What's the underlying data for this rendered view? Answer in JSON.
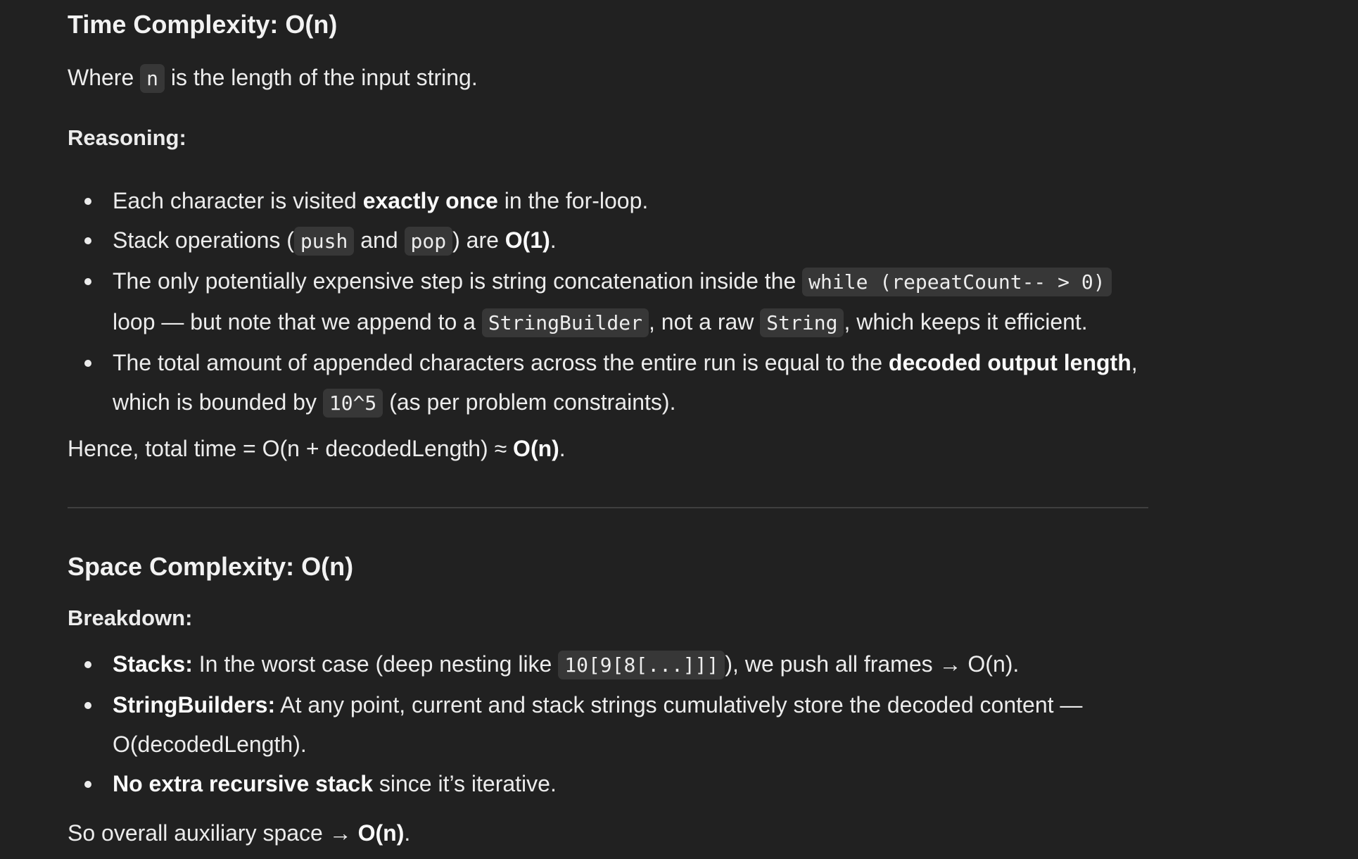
{
  "time": {
    "heading": "Time Complexity: O(n)",
    "where_pre": "Where ",
    "where_code": "n",
    "where_post": " is the length of the input string.",
    "reasoning_label": "Reasoning:",
    "bullets": {
      "b1": {
        "pre": "Each character is visited ",
        "bold": "exactly once",
        "post": " in the for-loop."
      },
      "b2": {
        "pre": "Stack operations (",
        "code1": "push",
        "mid": " and ",
        "code2": "pop",
        "post1": ") are ",
        "bold": "O(1)",
        "post2": "."
      },
      "b3": {
        "pre": "The only potentially expensive step is string concatenation inside the ",
        "code1": "while (repeatCount-- > 0)",
        "mid1": " loop — but note that we append to a ",
        "code2": "StringBuilder",
        "mid2": ", not a raw ",
        "code3": "String",
        "post": ", which keeps it efficient."
      },
      "b4": {
        "pre": "The total amount of appended characters across the entire run is equal to the ",
        "bold": "decoded output length",
        "mid": ", which is bounded by ",
        "code": "10^5",
        "post": " (as per problem constraints)."
      }
    },
    "hence_pre": "Hence, total time = O(n + decodedLength) ≈ ",
    "hence_bold": "O(n)",
    "hence_post": "."
  },
  "space": {
    "heading": "Space Complexity: O(n)",
    "breakdown_label": "Breakdown:",
    "bullets": {
      "b1": {
        "bold": "Stacks:",
        "pre": " In the worst case (deep nesting like ",
        "code": "10[9[8[...]]]",
        "post": "), we push all frames → O(n)."
      },
      "b2": {
        "bold": "StringBuilders:",
        "post": " At any point, current and stack strings cumulatively store the decoded content — O(decodedLength)."
      },
      "b3": {
        "bold": "No extra recursive stack",
        "post": " since it’s iterative."
      }
    },
    "overall_pre": "So overall auxiliary space → ",
    "overall_bold": "O(n)",
    "overall_post": "."
  }
}
